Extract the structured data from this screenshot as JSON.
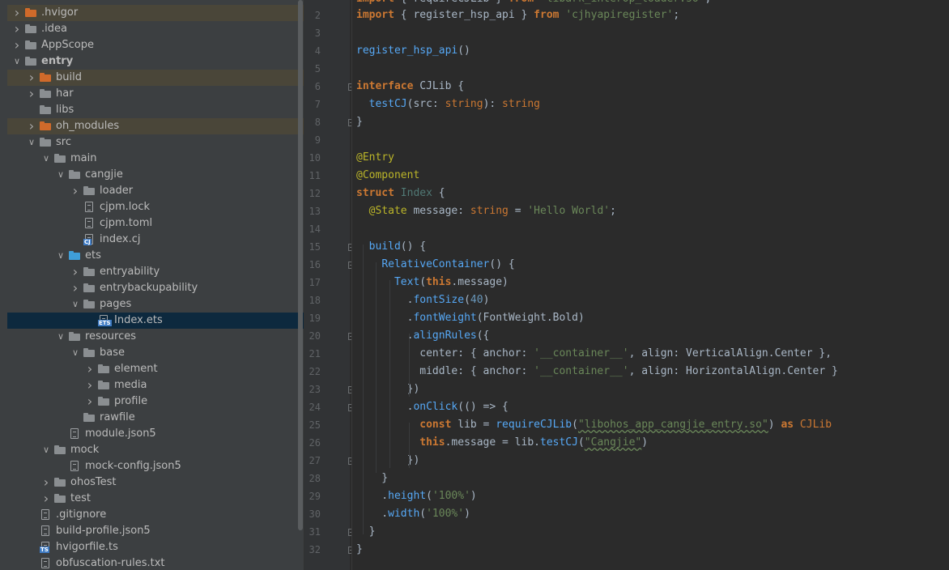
{
  "project_tree": [
    {
      "label": ".hvigor",
      "depth": 1,
      "expandable": true,
      "expanded": false,
      "icon": "folder-orange",
      "excluded": true
    },
    {
      "label": ".idea",
      "depth": 1,
      "expandable": true,
      "expanded": false,
      "icon": "folder-plain"
    },
    {
      "label": "AppScope",
      "depth": 1,
      "expandable": true,
      "expanded": false,
      "icon": "folder-plain"
    },
    {
      "label": "entry",
      "depth": 1,
      "expandable": true,
      "expanded": true,
      "icon": "folder-plain",
      "bold": true
    },
    {
      "label": "build",
      "depth": 2,
      "expandable": true,
      "expanded": false,
      "icon": "folder-orange",
      "excluded": true
    },
    {
      "label": "har",
      "depth": 2,
      "expandable": true,
      "expanded": false,
      "icon": "folder-plain"
    },
    {
      "label": "libs",
      "depth": 2,
      "expandable": false,
      "icon": "folder-plain"
    },
    {
      "label": "oh_modules",
      "depth": 2,
      "expandable": true,
      "expanded": false,
      "icon": "folder-orange",
      "excluded": true
    },
    {
      "label": "src",
      "depth": 2,
      "expandable": true,
      "expanded": true,
      "icon": "folder-plain"
    },
    {
      "label": "main",
      "depth": 3,
      "expandable": true,
      "expanded": true,
      "icon": "folder-plain"
    },
    {
      "label": "cangjie",
      "depth": 4,
      "expandable": true,
      "expanded": true,
      "icon": "folder-plain"
    },
    {
      "label": "loader",
      "depth": 5,
      "expandable": true,
      "expanded": false,
      "icon": "folder-plain"
    },
    {
      "label": "cjpm.lock",
      "depth": 5,
      "expandable": false,
      "icon": "file"
    },
    {
      "label": "cjpm.toml",
      "depth": 5,
      "expandable": false,
      "icon": "file"
    },
    {
      "label": "index.cj",
      "depth": 5,
      "expandable": false,
      "icon": "file-cj",
      "badge": "CJ"
    },
    {
      "label": "ets",
      "depth": 4,
      "expandable": true,
      "expanded": true,
      "icon": "folder-blue"
    },
    {
      "label": "entryability",
      "depth": 5,
      "expandable": true,
      "expanded": false,
      "icon": "folder-plain"
    },
    {
      "label": "entrybackupability",
      "depth": 5,
      "expandable": true,
      "expanded": false,
      "icon": "folder-plain"
    },
    {
      "label": "pages",
      "depth": 5,
      "expandable": true,
      "expanded": true,
      "icon": "folder-plain"
    },
    {
      "label": "Index.ets",
      "depth": 6,
      "expandable": false,
      "icon": "file-ets",
      "badge": "ETS",
      "selected": true
    },
    {
      "label": "resources",
      "depth": 4,
      "expandable": true,
      "expanded": true,
      "icon": "folder-plain"
    },
    {
      "label": "base",
      "depth": 5,
      "expandable": true,
      "expanded": true,
      "icon": "folder-plain"
    },
    {
      "label": "element",
      "depth": 6,
      "expandable": true,
      "expanded": false,
      "icon": "folder-plain"
    },
    {
      "label": "media",
      "depth": 6,
      "expandable": true,
      "expanded": false,
      "icon": "folder-plain"
    },
    {
      "label": "profile",
      "depth": 6,
      "expandable": true,
      "expanded": false,
      "icon": "folder-plain"
    },
    {
      "label": "rawfile",
      "depth": 5,
      "expandable": false,
      "icon": "folder-plain"
    },
    {
      "label": "module.json5",
      "depth": 4,
      "expandable": false,
      "icon": "file"
    },
    {
      "label": "mock",
      "depth": 3,
      "expandable": true,
      "expanded": true,
      "icon": "folder-plain"
    },
    {
      "label": "mock-config.json5",
      "depth": 4,
      "expandable": false,
      "icon": "file"
    },
    {
      "label": "ohosTest",
      "depth": 3,
      "expandable": true,
      "expanded": false,
      "icon": "folder-plain"
    },
    {
      "label": "test",
      "depth": 3,
      "expandable": true,
      "expanded": false,
      "icon": "folder-plain"
    },
    {
      "label": ".gitignore",
      "depth": 2,
      "expandable": false,
      "icon": "file"
    },
    {
      "label": "build-profile.json5",
      "depth": 2,
      "expandable": false,
      "icon": "file"
    },
    {
      "label": "hvigorfile.ts",
      "depth": 2,
      "expandable": false,
      "icon": "file-ts",
      "badge": "TS"
    },
    {
      "label": "obfuscation-rules.txt",
      "depth": 2,
      "expandable": false,
      "icon": "file"
    }
  ],
  "editor": {
    "lines": [
      {
        "n": "2",
        "tokens": [
          [
            "kw",
            "import"
          ],
          [
            "p",
            " { "
          ],
          [
            "p",
            "register_hsp_api"
          ],
          [
            "p",
            " } "
          ],
          [
            "kw",
            "from"
          ],
          [
            "p",
            " "
          ],
          [
            "str",
            "'cjhyapiregister'"
          ],
          [
            "p",
            ";"
          ]
        ]
      },
      {
        "n": "3",
        "tokens": []
      },
      {
        "n": "4",
        "tokens": [
          [
            "fn",
            "register_hsp_api"
          ],
          [
            "p",
            "()"
          ]
        ]
      },
      {
        "n": "5",
        "tokens": []
      },
      {
        "n": "6",
        "tokens": [
          [
            "kw",
            "interface"
          ],
          [
            "p",
            " "
          ],
          [
            "iface",
            "CJLib"
          ],
          [
            "p",
            " {"
          ]
        ],
        "fold": true
      },
      {
        "n": "7",
        "tokens": [
          [
            "p",
            "  "
          ],
          [
            "mth",
            "testCJ"
          ],
          [
            "p",
            "(src: "
          ],
          [
            "ty",
            "string"
          ],
          [
            "p",
            "): "
          ],
          [
            "ty",
            "string"
          ]
        ]
      },
      {
        "n": "8",
        "tokens": [
          [
            "p",
            "}"
          ]
        ],
        "fold": true
      },
      {
        "n": "9",
        "tokens": []
      },
      {
        "n": "10",
        "tokens": [
          [
            "ann",
            "@Entry"
          ]
        ]
      },
      {
        "n": "11",
        "tokens": [
          [
            "ann",
            "@Component"
          ]
        ]
      },
      {
        "n": "12",
        "tokens": [
          [
            "kw",
            "struct"
          ],
          [
            "p",
            " "
          ],
          [
            "cls",
            "Index"
          ],
          [
            "p",
            " {"
          ]
        ]
      },
      {
        "n": "13",
        "tokens": [
          [
            "p",
            "  "
          ],
          [
            "ann",
            "@State"
          ],
          [
            "p",
            " message: "
          ],
          [
            "ty",
            "string"
          ],
          [
            "p",
            " = "
          ],
          [
            "str",
            "'Hello World'"
          ],
          [
            "p",
            ";"
          ]
        ]
      },
      {
        "n": "14",
        "tokens": []
      },
      {
        "n": "15",
        "tokens": [
          [
            "p",
            "  "
          ],
          [
            "mth",
            "build"
          ],
          [
            "p",
            "() {"
          ]
        ],
        "fold": true
      },
      {
        "n": "16",
        "tokens": [
          [
            "p",
            "    "
          ],
          [
            "fn",
            "RelativeContainer"
          ],
          [
            "p",
            "() {"
          ]
        ],
        "fold": true
      },
      {
        "n": "17",
        "tokens": [
          [
            "p",
            "      "
          ],
          [
            "fn",
            "Text"
          ],
          [
            "p",
            "("
          ],
          [
            "kw",
            "this"
          ],
          [
            "p",
            ".message)"
          ]
        ]
      },
      {
        "n": "18",
        "tokens": [
          [
            "p",
            "        ."
          ],
          [
            "mth",
            "fontSize"
          ],
          [
            "p",
            "("
          ],
          [
            "num",
            "40"
          ],
          [
            "p",
            ")"
          ]
        ]
      },
      {
        "n": "19",
        "tokens": [
          [
            "p",
            "        ."
          ],
          [
            "mth",
            "fontWeight"
          ],
          [
            "p",
            "(FontWeight.Bold)"
          ]
        ]
      },
      {
        "n": "20",
        "tokens": [
          [
            "p",
            "        ."
          ],
          [
            "mth",
            "alignRules"
          ],
          [
            "p",
            "({"
          ]
        ],
        "fold": true
      },
      {
        "n": "21",
        "tokens": [
          [
            "p",
            "          center: { anchor: "
          ],
          [
            "str",
            "'__container__'"
          ],
          [
            "p",
            ", align: VerticalAlign.Center },"
          ]
        ]
      },
      {
        "n": "22",
        "tokens": [
          [
            "p",
            "          middle: { anchor: "
          ],
          [
            "str",
            "'__container__'"
          ],
          [
            "p",
            ", align: HorizontalAlign.Center }"
          ]
        ]
      },
      {
        "n": "23",
        "tokens": [
          [
            "p",
            "        })"
          ]
        ],
        "fold": true
      },
      {
        "n": "24",
        "tokens": [
          [
            "p",
            "        ."
          ],
          [
            "mth",
            "onClick"
          ],
          [
            "p",
            "(() => {"
          ]
        ],
        "fold": true
      },
      {
        "n": "25",
        "tokens": [
          [
            "p",
            "          "
          ],
          [
            "kw",
            "const"
          ],
          [
            "p",
            " lib = "
          ],
          [
            "fn",
            "requireCJLib"
          ],
          [
            "p",
            "("
          ],
          [
            "str",
            "\"libohos_app_cangjie_entry.so\""
          ],
          [
            "p",
            ") "
          ],
          [
            "kw",
            "as"
          ],
          [
            "p",
            " "
          ],
          [
            "ty",
            "CJLib"
          ]
        ]
      },
      {
        "n": "26",
        "tokens": [
          [
            "p",
            "          "
          ],
          [
            "kw",
            "this"
          ],
          [
            "p",
            ".message = lib."
          ],
          [
            "mth",
            "testCJ"
          ],
          [
            "p",
            "("
          ],
          [
            "str",
            "\"Cangjie\""
          ],
          [
            "p",
            ")"
          ]
        ]
      },
      {
        "n": "27",
        "tokens": [
          [
            "p",
            "        })"
          ]
        ],
        "fold": true
      },
      {
        "n": "28",
        "tokens": [
          [
            "p",
            "    }"
          ]
        ]
      },
      {
        "n": "29",
        "tokens": [
          [
            "p",
            "    ."
          ],
          [
            "mth",
            "height"
          ],
          [
            "p",
            "("
          ],
          [
            "str",
            "'100%'"
          ],
          [
            "p",
            ")"
          ]
        ]
      },
      {
        "n": "30",
        "tokens": [
          [
            "p",
            "    ."
          ],
          [
            "mth",
            "width"
          ],
          [
            "p",
            "("
          ],
          [
            "str",
            "'100%'"
          ],
          [
            "p",
            ")"
          ]
        ]
      },
      {
        "n": "31",
        "tokens": [
          [
            "p",
            "  }"
          ]
        ],
        "fold": true
      },
      {
        "n": "32",
        "tokens": [
          [
            "p",
            "}"
          ]
        ],
        "fold": true
      }
    ]
  }
}
